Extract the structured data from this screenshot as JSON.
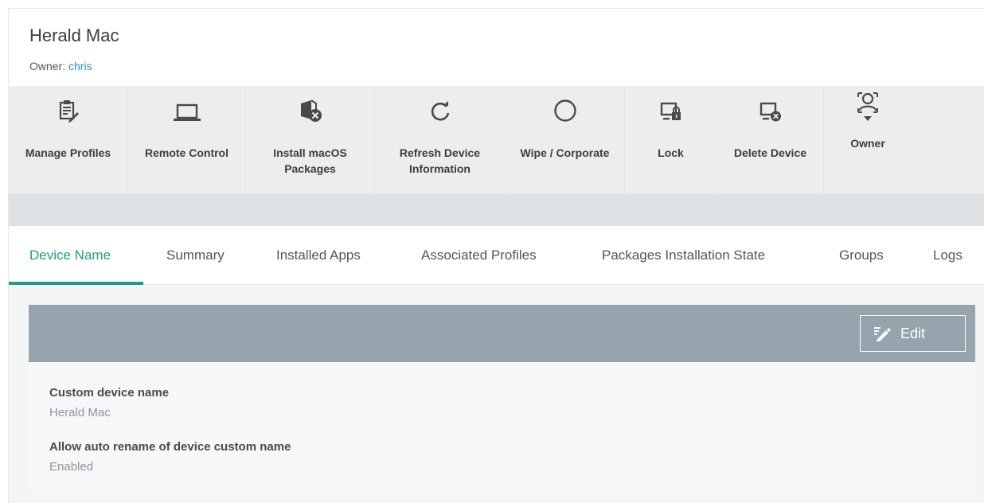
{
  "device": {
    "title": "Herald Mac",
    "owner_prefix": "Owner: ",
    "owner_name": "chris"
  },
  "toolbar": {
    "items": [
      {
        "label": "Manage Profiles",
        "icon": "manage-profiles-icon"
      },
      {
        "label": "Remote Control",
        "icon": "laptop-icon"
      },
      {
        "label": "Install macOS\nPackages",
        "icon": "install-package-icon"
      },
      {
        "label": "Refresh Device\nInformation",
        "icon": "refresh-icon"
      },
      {
        "label": "Wipe / Corporate",
        "icon": "circle-icon"
      },
      {
        "label": "Lock",
        "icon": "device-lock-icon"
      },
      {
        "label": "Delete Device",
        "icon": "device-delete-icon"
      },
      {
        "label": "Owner",
        "icon": "owner-icon"
      }
    ]
  },
  "tabs": [
    {
      "label": "Device Name",
      "active": true
    },
    {
      "label": "Summary"
    },
    {
      "label": "Installed Apps"
    },
    {
      "label": "Associated Profiles"
    },
    {
      "label": "Packages Installation State"
    },
    {
      "label": "Groups"
    },
    {
      "label": "Logs"
    }
  ],
  "panel": {
    "edit_label": "Edit",
    "fields": [
      {
        "label": "Custom device name",
        "value": "Herald Mac"
      },
      {
        "label": "Allow auto rename of device custom name",
        "value": "Enabled"
      }
    ]
  },
  "colors": {
    "accent": "#1f9c84",
    "link": "#2a8bd0",
    "panel_header": "#96a4ae"
  }
}
